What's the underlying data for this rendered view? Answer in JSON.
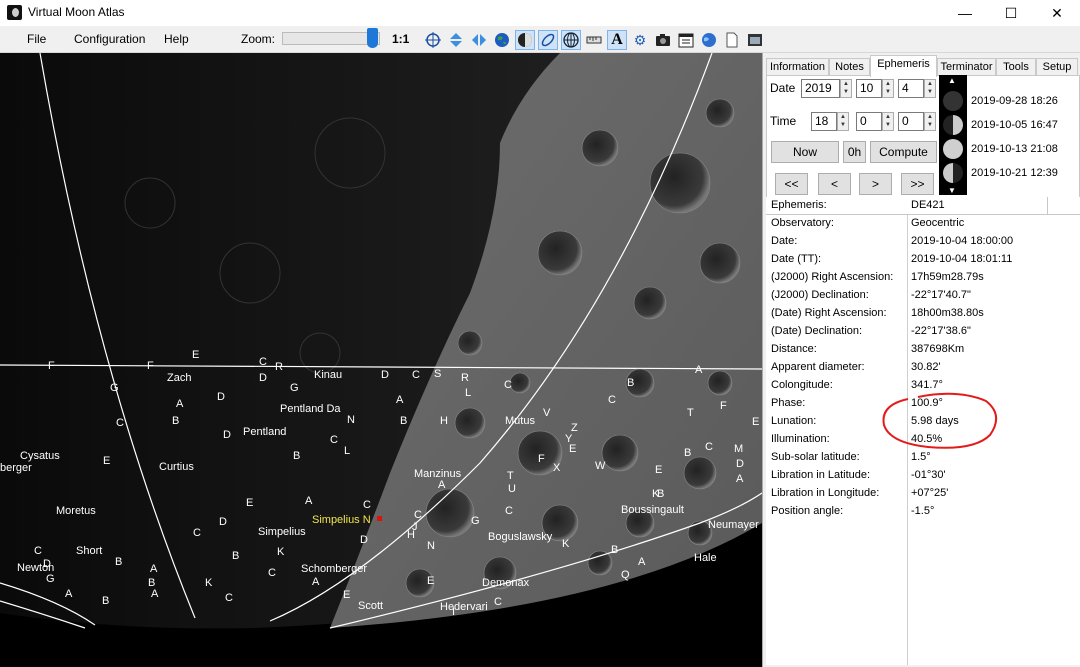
{
  "window": {
    "title": "Virtual Moon Atlas",
    "minimize": "—",
    "maximize": "☐",
    "close": "✕"
  },
  "menu": {
    "file": "File",
    "configuration": "Configuration",
    "help": "Help"
  },
  "toolbar": {
    "zoom_label": "Zoom:",
    "zoom_level": 0.92,
    "zoom_ratio": "1:1",
    "icons": [
      "target-icon",
      "flip-vertical-icon",
      "flip-horizontal-icon",
      "earth-icon",
      "moon-phase-icon",
      "orbit-icon",
      "grid-icon",
      "ruler-icon",
      "text-icon",
      "gear-icon",
      "camera-icon",
      "calendar-icon",
      "globe-icon",
      "document-icon",
      "window-icon"
    ]
  },
  "map": {
    "labels": [
      {
        "text": "E"
      },
      {
        "text": "F"
      },
      {
        "text": "F"
      },
      {
        "text": "C"
      },
      {
        "text": "R"
      },
      {
        "text": "Zach"
      },
      {
        "text": "D"
      },
      {
        "text": "Kinau"
      },
      {
        "text": "D"
      },
      {
        "text": "C"
      },
      {
        "text": "S"
      },
      {
        "text": "R"
      },
      {
        "text": "G"
      },
      {
        "text": "G"
      },
      {
        "text": "D"
      },
      {
        "text": "A"
      },
      {
        "text": "L"
      },
      {
        "text": "C"
      },
      {
        "text": "B"
      },
      {
        "text": "A"
      },
      {
        "text": "Pentland Da"
      },
      {
        "text": "A"
      },
      {
        "text": "N"
      },
      {
        "text": "B"
      },
      {
        "text": "H"
      },
      {
        "text": "C"
      },
      {
        "text": "C"
      },
      {
        "text": "B"
      },
      {
        "text": "D"
      },
      {
        "text": "Pentland"
      },
      {
        "text": "C"
      },
      {
        "text": "L"
      },
      {
        "text": "Mutus"
      },
      {
        "text": "V"
      },
      {
        "text": "Cysatus"
      },
      {
        "text": "berger"
      },
      {
        "text": "E"
      },
      {
        "text": "Curtius"
      },
      {
        "text": "B"
      },
      {
        "text": "Manzinus"
      },
      {
        "text": "A"
      },
      {
        "text": "T"
      },
      {
        "text": "U"
      },
      {
        "text": "Moretus"
      },
      {
        "text": "E"
      },
      {
        "text": "A"
      },
      {
        "text": "D"
      },
      {
        "text": "C"
      },
      {
        "text": "Simpelius N"
      },
      {
        "text": "C"
      },
      {
        "text": "J"
      },
      {
        "text": "C"
      },
      {
        "text": "Short"
      },
      {
        "text": "C"
      },
      {
        "text": "Simpelius"
      },
      {
        "text": "D"
      },
      {
        "text": "H"
      },
      {
        "text": "N"
      },
      {
        "text": "G"
      },
      {
        "text": "Newton"
      },
      {
        "text": "D"
      },
      {
        "text": "B"
      },
      {
        "text": "B"
      },
      {
        "text": "K"
      },
      {
        "text": "Boguslawsky"
      },
      {
        "text": "K"
      },
      {
        "text": "G"
      },
      {
        "text": "A"
      },
      {
        "text": "C"
      },
      {
        "text": "Schomberger"
      },
      {
        "text": "A"
      },
      {
        "text": "B"
      },
      {
        "text": "K"
      },
      {
        "text": "A"
      },
      {
        "text": "A"
      },
      {
        "text": "B"
      },
      {
        "text": "C"
      },
      {
        "text": "E"
      },
      {
        "text": "Demonax"
      },
      {
        "text": "Scott"
      },
      {
        "text": "Hedervari"
      },
      {
        "text": "C"
      },
      {
        "text": "Boussingault"
      },
      {
        "text": "Neumayer"
      },
      {
        "text": "Hale"
      },
      {
        "text": "B"
      },
      {
        "text": "Q"
      },
      {
        "text": "A"
      },
      {
        "text": "E"
      },
      {
        "text": "K"
      },
      {
        "text": "Z"
      },
      {
        "text": "Y"
      },
      {
        "text": "E"
      },
      {
        "text": "X"
      },
      {
        "text": "W"
      },
      {
        "text": "F"
      },
      {
        "text": "B"
      },
      {
        "text": "C"
      },
      {
        "text": "M"
      },
      {
        "text": "D"
      },
      {
        "text": "T"
      },
      {
        "text": "F"
      },
      {
        "text": "E"
      },
      {
        "text": "A"
      },
      {
        "text": "B"
      },
      {
        "text": "C"
      },
      {
        "text": "E"
      },
      {
        "text": "I"
      }
    ]
  },
  "side": {
    "tabs": [
      "Information",
      "Notes",
      "Ephemeris",
      "Terminator",
      "Tools",
      "Setup"
    ],
    "date_label": "Date",
    "time_label": "Time",
    "date": {
      "year": "2019",
      "month": "10",
      "day": "4"
    },
    "time": {
      "hour": "18",
      "minute": "0",
      "second": "0"
    },
    "buttons": {
      "now": "Now",
      "zero_h": "0h",
      "compute": "Compute",
      "first": "<<",
      "prev": "<",
      "next": ">",
      "last": ">>"
    },
    "phases": [
      {
        "date": "2019-09-28 18:26"
      },
      {
        "date": "2019-10-05 16:47"
      },
      {
        "date": "2019-10-13 21:08"
      },
      {
        "date": "2019-10-21 12:39"
      }
    ],
    "ephemeris": [
      {
        "key": "Ephemeris:",
        "value": "DE421"
      },
      {
        "key": "Observatory:",
        "value": "Geocentric"
      },
      {
        "key": "Date:",
        "value": "2019-10-04 18:00:00"
      },
      {
        "key": "Date (TT):",
        "value": "2019-10-04 18:01:11"
      },
      {
        "key": "(J2000) Right Ascension:",
        "value": " 17h59m28.79s"
      },
      {
        "key": "(J2000) Declination:",
        "value": "-22°17'40.7\""
      },
      {
        "key": "(Date) Right Ascension:",
        "value": " 18h00m38.80s"
      },
      {
        "key": "(Date) Declination:",
        "value": "-22°17'38.6\""
      },
      {
        "key": "Distance:",
        "value": "387698Km"
      },
      {
        "key": "Apparent diameter:",
        "value": "30.82'"
      },
      {
        "key": "Colongitude:",
        "value": "341.7°"
      },
      {
        "key": "Phase:",
        "value": "100.9°"
      },
      {
        "key": "Lunation:",
        "value": "5.98 days"
      },
      {
        "key": "Illumination:",
        "value": "40.5%"
      },
      {
        "key": "Sub-solar latitude:",
        "value": "1.5°"
      },
      {
        "key": "Libration in Latitude:",
        "value": "-01°30'"
      },
      {
        "key": "Libration in Longitude:",
        "value": "+07°25'"
      },
      {
        "key": "Position angle:",
        "value": "-1.5°"
      }
    ],
    "annotation_color": "#e31b1b"
  }
}
